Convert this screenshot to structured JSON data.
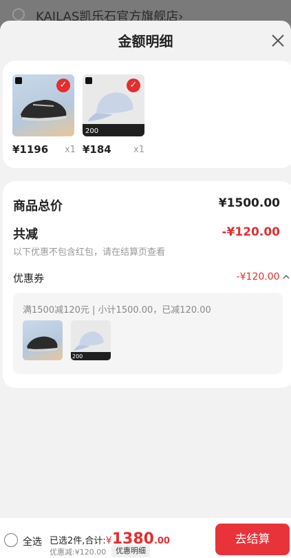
{
  "background": {
    "store_name": "KAILAS凯乐石官方旗舰店",
    "store_chevron": "›"
  },
  "sheet": {
    "title": "金额明细",
    "close_icon": "close-icon"
  },
  "products": [
    {
      "name": "trail-shoe",
      "price": "¥1196",
      "qty": "x1",
      "image_label": ""
    },
    {
      "name": "cap",
      "price": "¥184",
      "qty": "x1",
      "image_label": "200"
    }
  ],
  "summary": {
    "total_label": "商品总价",
    "total_value": "¥1500.00",
    "reduce_label": "共减",
    "reduce_value": "-¥120.00",
    "reduce_note": "以下优惠不包含红包，请在结算页查看",
    "coupon_label": "优惠券",
    "coupon_value": "-¥120.00",
    "coupon_toggle_icon": "chevron-up-icon",
    "coupon_detail": "满1500减120元 | 小计1500.00，已减120.00",
    "coupon_thumbs": [
      {
        "name": "trail-shoe"
      },
      {
        "name": "cap",
        "image_label": "200"
      }
    ]
  },
  "bottom": {
    "select_all": "全选",
    "selected_text": "已选2件,合计:",
    "sum_yen": "¥",
    "sum_integer": "1380",
    "sum_decimal": ".00",
    "discount_note": "优惠减:¥120.00",
    "detail_chip": "优惠明细",
    "checkout": "去结算"
  },
  "colors": {
    "accent": "#e52d2d",
    "checkout_bg": "#e8333a"
  }
}
